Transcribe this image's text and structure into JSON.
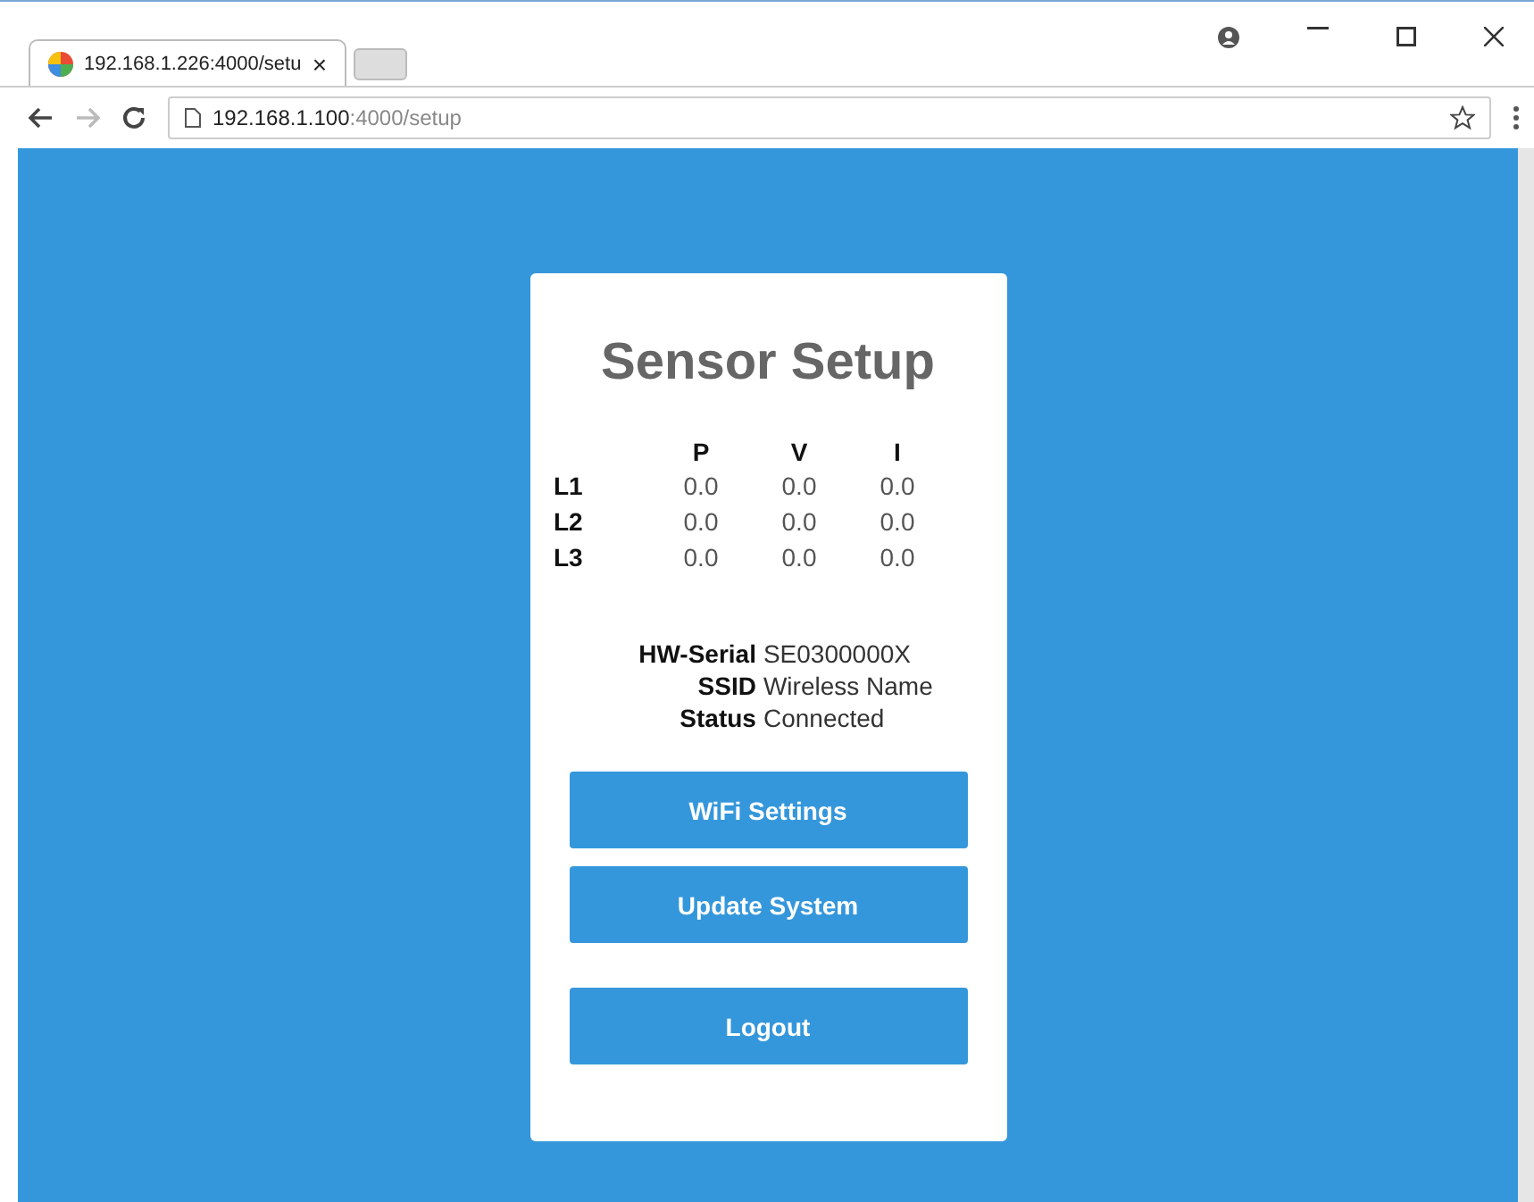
{
  "browser": {
    "tab": {
      "title": "192.168.1.226:4000/setu",
      "close": "×",
      "selected": true
    },
    "address": {
      "host": "192.168.1.100",
      "path": ":4000/setup"
    }
  },
  "page": {
    "title": "Sensor Setup",
    "table": {
      "columns": [
        "P",
        "V",
        "I"
      ],
      "rows": [
        {
          "label": "L1",
          "values": [
            "0.0",
            "0.0",
            "0.0"
          ]
        },
        {
          "label": "L2",
          "values": [
            "0.0",
            "0.0",
            "0.0"
          ]
        },
        {
          "label": "L3",
          "values": [
            "0.0",
            "0.0",
            "0.0"
          ]
        }
      ]
    },
    "info": [
      {
        "label": "HW-Serial",
        "value": "SE0300000X"
      },
      {
        "label": "SSID",
        "value": "Wireless Name"
      },
      {
        "label": "Status",
        "value": "Connected"
      }
    ],
    "buttons": [
      "WiFi Settings",
      "Update System"
    ],
    "logout": "Logout"
  }
}
